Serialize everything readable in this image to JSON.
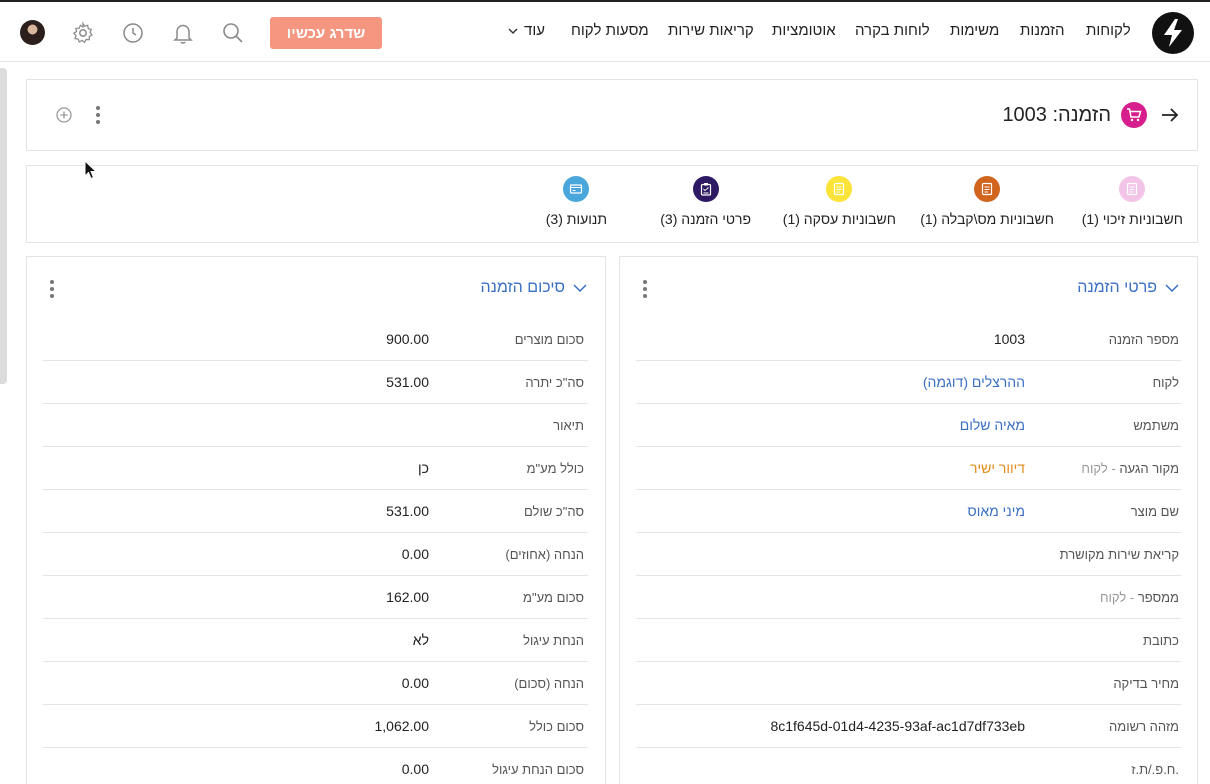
{
  "nav": {
    "items": [
      "לקוחות",
      "הזמנות",
      "משימות",
      "לוחות בקרה",
      "אוטומציות",
      "קריאות שירות",
      "מסעות לקוח"
    ],
    "more_label": "עוד",
    "upgrade_label": "שדרג עכשיו"
  },
  "record": {
    "title": "הזמנה: 1003"
  },
  "related": [
    {
      "label": "חשבוניות זיכוי (1)",
      "color": "#f2c4e8",
      "icon": "document-icon"
    },
    {
      "label": "חשבוניות מס\\קבלה (1)",
      "color": "#d2651e",
      "icon": "document-icon"
    },
    {
      "label": "חשבוניות עסקה (1)",
      "color": "#fbe33a",
      "icon": "document-icon"
    },
    {
      "label": "פרטי הזמנה (3)",
      "color": "#2e1a63",
      "icon": "clipboard-icon"
    },
    {
      "label": "תנועות (3)",
      "color": "#49a7db",
      "icon": "card-icon"
    }
  ],
  "details_panel": {
    "title": "פרטי הזמנה",
    "fields": [
      {
        "label": "מספר הזמנה",
        "sublabel": "",
        "value": "1003",
        "style": ""
      },
      {
        "label": "לקוח",
        "sublabel": "",
        "value": "ההרצלים (דוגמה)",
        "style": "link"
      },
      {
        "label": "משתמש",
        "sublabel": "",
        "value": "מאיה שלום",
        "style": "link"
      },
      {
        "label": "מקור הגעה",
        "sublabel": " - לקוח",
        "value": "דיוור ישיר",
        "style": "orange"
      },
      {
        "label": "שם מוצר",
        "sublabel": "",
        "value": "מיני מאוס",
        "style": "link"
      },
      {
        "label": "קריאת שירות מקושרת",
        "sublabel": "",
        "value": "",
        "style": ""
      },
      {
        "label": "ממספר",
        "sublabel": " - לקוח",
        "value": "",
        "style": ""
      },
      {
        "label": "כתובת",
        "sublabel": "",
        "value": "",
        "style": ""
      },
      {
        "label": "מחיר בדיקה",
        "sublabel": "",
        "value": "",
        "style": ""
      },
      {
        "label": "מזהה רשומה",
        "sublabel": "",
        "value": "8c1f645d-01d4-4235-93af-ac1d7df733eb",
        "style": ""
      },
      {
        "label": "ח.פ./ת.ז.",
        "sublabel": "",
        "value": "",
        "style": ""
      }
    ]
  },
  "summary_panel": {
    "title": "סיכום הזמנה",
    "fields": [
      {
        "label": "סכום מוצרים",
        "value": "900.00"
      },
      {
        "label": "סה\"כ יתרה",
        "value": "531.00"
      },
      {
        "label": "תיאור",
        "value": ""
      },
      {
        "label": "כולל מע\"מ",
        "value": "כן"
      },
      {
        "label": "סה\"כ שולם",
        "value": "531.00"
      },
      {
        "label": "הנחה (אחוזים)",
        "value": "0.00"
      },
      {
        "label": "סכום מע\"מ",
        "value": "162.00"
      },
      {
        "label": "הנחת עיגול",
        "value": "לא"
      },
      {
        "label": "הנחה (סכום)",
        "value": "0.00"
      },
      {
        "label": "סכום כולל",
        "value": "1,062.00"
      },
      {
        "label": "סכום הנחת עיגול",
        "value": "0.00"
      }
    ]
  }
}
